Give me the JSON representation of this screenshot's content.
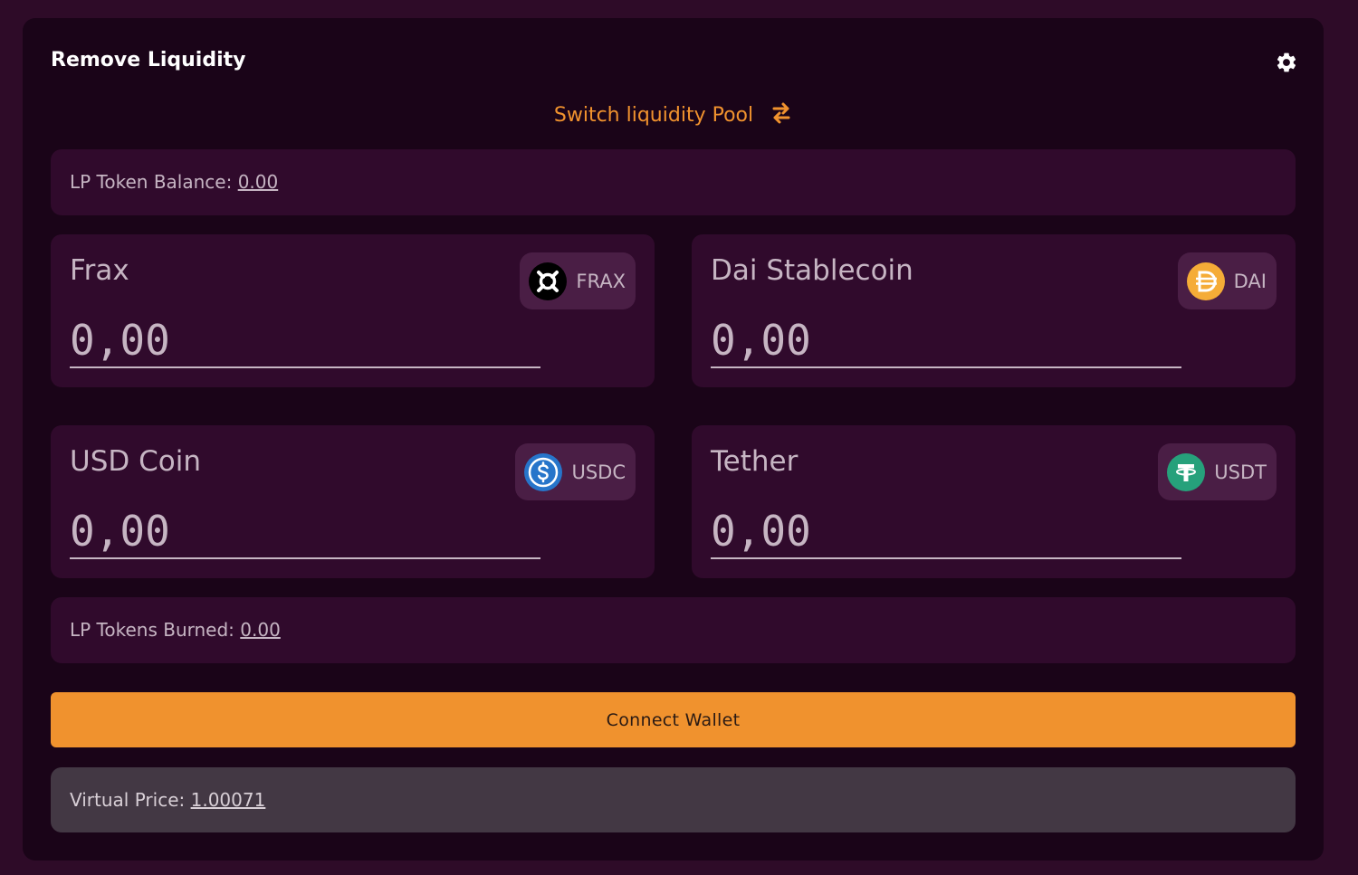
{
  "header": {
    "title": "Remove Liquidity",
    "settings_icon": "gear-icon"
  },
  "switch_pool": {
    "label": "Switch liquidity Pool",
    "icon": "swap-arrows-icon"
  },
  "lp_balance": {
    "label": "LP Token Balance:",
    "value": "0.00"
  },
  "tokens": [
    {
      "name": "Frax",
      "symbol": "FRAX",
      "placeholder": "0,00",
      "icon": "frax-icon",
      "color": "#000000"
    },
    {
      "name": "Dai Stablecoin",
      "symbol": "DAI",
      "placeholder": "0,00",
      "icon": "dai-icon",
      "color": "#f5ac37"
    },
    {
      "name": "USD Coin",
      "symbol": "USDC",
      "placeholder": "0,00",
      "icon": "usdc-icon",
      "color": "#2775ca"
    },
    {
      "name": "Tether",
      "symbol": "USDT",
      "placeholder": "0,00",
      "icon": "usdt-icon",
      "color": "#26a17b"
    }
  ],
  "lp_burned": {
    "label": "LP Tokens Burned:",
    "value": "0.00"
  },
  "connect_button": {
    "label": "Connect Wallet"
  },
  "virtual_price": {
    "label": "Virtual Price:",
    "value": "1.00071"
  },
  "colors": {
    "accent": "#f0922e",
    "background": "#2e0b28",
    "panel": "#1a0418",
    "card": "#300a2c"
  }
}
